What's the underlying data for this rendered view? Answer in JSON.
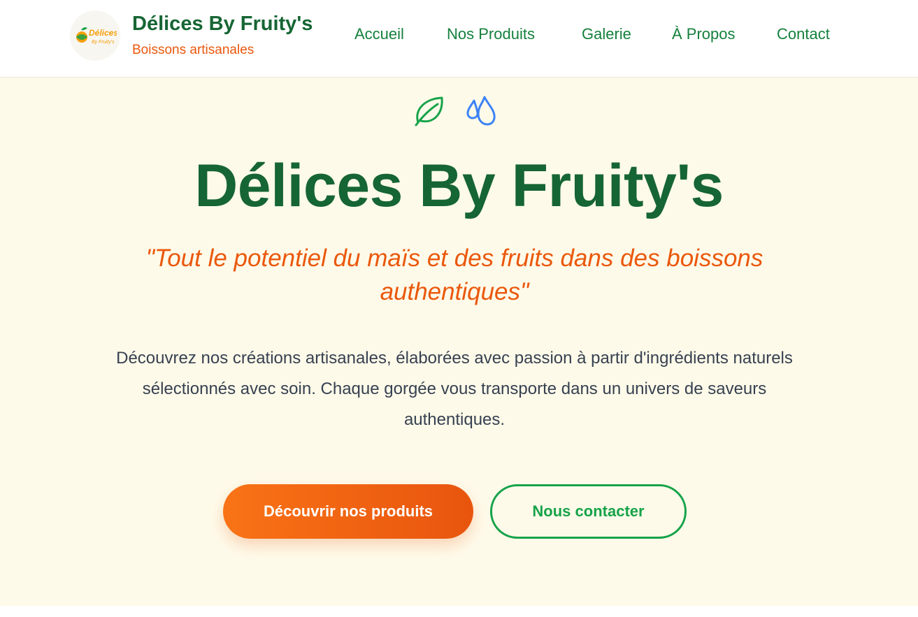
{
  "header": {
    "logo": {
      "text": "Délices",
      "subtext": "By Fruity's",
      "accent_color": "#f59e0b"
    },
    "brand_name": "Délices By Fruity's",
    "brand_tagline": "Boissons artisanales",
    "nav": [
      {
        "label": "Accueil"
      },
      {
        "label": "Nos Produits"
      },
      {
        "label": "Galerie"
      },
      {
        "label": "À Propos"
      },
      {
        "label": "Contact"
      }
    ]
  },
  "hero": {
    "icons": [
      "leaf-icon",
      "droplets-icon"
    ],
    "title": "Délices By Fruity's",
    "tagline": "\"Tout le potentiel du maïs et des fruits dans des boissons authentiques\"",
    "description": "Découvrez nos créations artisanales, élaborées avec passion à partir d'ingrédients naturels sélectionnés avec soin. Chaque gorgée vous transporte dans un univers de saveurs authentiques.",
    "primary_button": "Découvrir nos produits",
    "secondary_button": "Nous contacter"
  },
  "colors": {
    "brand_green": "#166534",
    "nav_green": "#15803d",
    "accent_orange": "#ea580c",
    "hero_background": "#fefae9",
    "leaf_icon": "#16a34a",
    "droplets_icon": "#3b82f6"
  }
}
